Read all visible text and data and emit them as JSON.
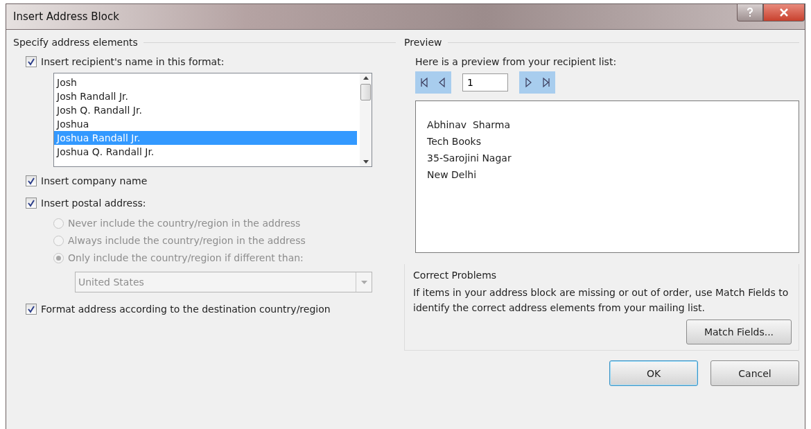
{
  "window": {
    "title": "Insert Address Block"
  },
  "left": {
    "title": "Specify address elements",
    "name_format": {
      "label": "Insert recipient's name in this format:",
      "checked": true
    },
    "name_list": [
      {
        "label": "Josh",
        "selected": false
      },
      {
        "label": "Josh Randall Jr.",
        "selected": false
      },
      {
        "label": "Josh Q. Randall Jr.",
        "selected": false
      },
      {
        "label": "Joshua",
        "selected": false
      },
      {
        "label": "Joshua Randall Jr.",
        "selected": true
      },
      {
        "label": "Joshua Q. Randall Jr.",
        "selected": false
      }
    ],
    "company": {
      "label": "Insert company name",
      "checked": true
    },
    "postal": {
      "label": "Insert postal address:",
      "checked": true
    },
    "country_options": [
      {
        "label": "Never include the country/region in the address",
        "selected": false,
        "disabled": true
      },
      {
        "label": "Always include the country/region in the address",
        "selected": false,
        "disabled": true
      },
      {
        "label": "Only include the country/region if different than:",
        "selected": true,
        "disabled": true
      }
    ],
    "country_select": {
      "value": "United States",
      "disabled": true
    },
    "format": {
      "label": "Format address according to the destination country/region",
      "checked": true
    }
  },
  "preview": {
    "title": "Preview",
    "caption": "Here is a preview from your recipient list:",
    "record": "1",
    "lines": [
      "Abhinav  Sharma",
      "Tech Books",
      "35-Sarojini Nagar",
      "New Delhi"
    ]
  },
  "correct": {
    "title": "Correct Problems",
    "text": "If items in your address block are missing or out of order, use Match Fields to identify the correct address elements from your mailing list.",
    "button": "Match Fields..."
  },
  "buttons": [
    {
      "label": "OK",
      "default": true
    },
    {
      "label": "Cancel",
      "default": false
    }
  ]
}
